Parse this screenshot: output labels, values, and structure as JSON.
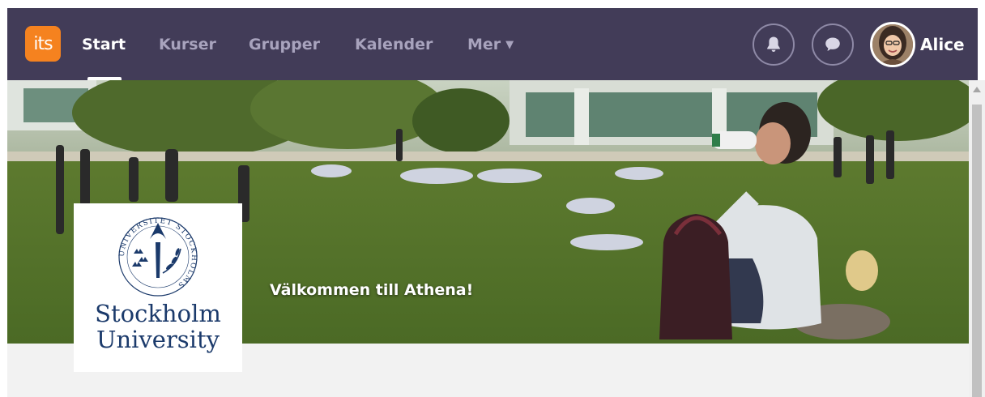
{
  "app": {
    "logo_text": "its",
    "brand_color": "#f5821f",
    "navbar_color": "#423c58"
  },
  "nav": {
    "items": [
      {
        "label": "Start",
        "active": true
      },
      {
        "label": "Kurser",
        "active": false
      },
      {
        "label": "Grupper",
        "active": false
      },
      {
        "label": "Kalender",
        "active": false
      },
      {
        "label": "Mer",
        "active": false,
        "icon": "caret-down-icon"
      }
    ],
    "notifications_icon": "bell-icon",
    "messages_icon": "chat-bubble-icon",
    "user": {
      "name": "Alice",
      "avatar_icon": "user-avatar"
    }
  },
  "hero": {
    "welcome_text": "Välkommen till Athena!",
    "image_description_icon": "campus-lawn-photo"
  },
  "institution": {
    "name_line1": "Stockholm",
    "name_line2": "University",
    "seal_text": "UNIVERSITET STOCKHOLMS",
    "brand_color": "#1b3a6b"
  }
}
